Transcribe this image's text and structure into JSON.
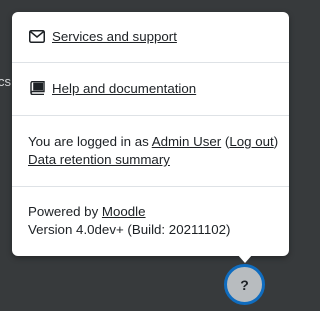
{
  "background": {
    "peek_text": "cs"
  },
  "footer_popover": {
    "services_link": {
      "icon": "envelope-icon",
      "label": "Services and support"
    },
    "help_link": {
      "icon": "book-icon",
      "label": "Help and documentation"
    },
    "login_info": {
      "prefix": "You are logged in as ",
      "user_name": "Admin User",
      "open_paren": " (",
      "logout_label": "Log out",
      "close_paren": ")",
      "data_retention_label": "Data retention summary"
    },
    "powered_by": {
      "prefix": "Powered by ",
      "moodle_label": "Moodle",
      "version": "Version 4.0dev+ (Build: 20211102)"
    }
  },
  "help_button": {
    "label": "?",
    "icon": "question-icon"
  },
  "colors": {
    "backdrop": "#373a3c",
    "popover_bg": "#ffffff",
    "help_button_bg": "#b8bcbf",
    "help_button_border": "#0f6cbf",
    "text": "#1d2125"
  }
}
